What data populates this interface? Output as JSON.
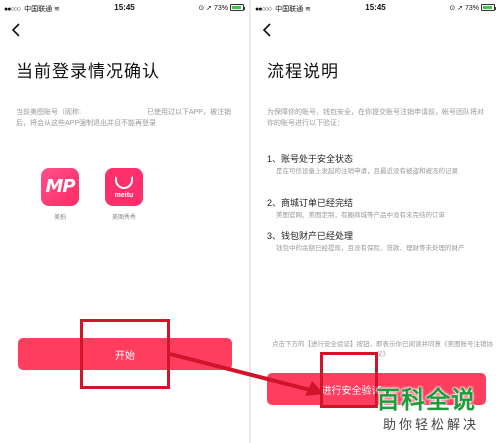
{
  "status_bar": {
    "carrier": "中国联通",
    "time": "15:45",
    "battery": "73%"
  },
  "left": {
    "title": "当前登录情况确认",
    "desc_part1": "当前美图账号（昵称:",
    "desc_part2": "已使用过以下APP，被注销后，将会从这些APP强制退出并且不能再登录",
    "apps": [
      {
        "icon_text": "MP",
        "label": "美拍"
      },
      {
        "icon_text": "meitu",
        "label": "美图秀秀"
      }
    ],
    "start_button": "开始"
  },
  "right": {
    "title": "流程说明",
    "desc": "为保障你的账号、钱包安全，在你提交账号注销申请前，帐号团队将对你的账号进行以下验证：",
    "items": [
      {
        "title": "1、账号处于安全状态",
        "sub": "是在可信设备上发起的注销申请，且最近没有被盗和被冻的记录"
      },
      {
        "title": "2、商城订单已经完结",
        "sub": "美图官网、美图定制，有圈商城等产品中没有未完结的订单"
      },
      {
        "title": "3、钱包财产已经处理",
        "sub": "钱包中的余额已经提现，且没有保险、贷款、理财等未处理的财产"
      }
    ],
    "footnote": "点击下方的【进行安全验证】按钮，即表示你已阅读并同意《美图账号注销协议》",
    "verify_button": "进行安全验证"
  },
  "watermark": {
    "main": "百科全说",
    "sub": "助你轻松解决"
  },
  "colors": {
    "accent": "#ff3d5f",
    "annotation": "#d0152b",
    "watermark_green": "#1b9e3a"
  },
  "icons": [
    "back-arrow-icon",
    "wifi-icon",
    "lock-rotation-icon",
    "location-icon",
    "battery-icon"
  ]
}
